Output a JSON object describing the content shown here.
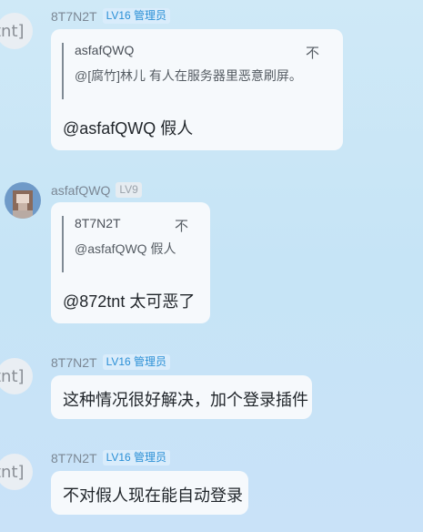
{
  "messages": [
    {
      "avatar_text": "tnt]",
      "sender": "8T7N2T",
      "badge": "LV16 管理员",
      "quote": {
        "author": "asfafQWQ",
        "mark": "不",
        "text": "@[腐竹]林儿 有人在服务器里恶意刷屏。"
      },
      "text": "@asfafQWQ 假人"
    },
    {
      "sender": "asfafQWQ",
      "badge": "LV9",
      "quote": {
        "author": "8T7N2T",
        "mark": "不",
        "text": "@asfafQWQ 假人"
      },
      "text": "@872tnt 太可恶了"
    },
    {
      "avatar_text": "tnt]",
      "sender": "8T7N2T",
      "badge": "LV16 管理员",
      "text": "这种情况很好解决，加个登录插件"
    },
    {
      "avatar_text": "tnt]",
      "sender": "8T7N2T",
      "badge": "LV16 管理员",
      "text": "不对假人现在能自动登录"
    }
  ],
  "colors": {
    "background": "#cfe9f7",
    "bubble": "#f6f9fc",
    "admin_badge_text": "#2a8fd6",
    "admin_badge_bg": "#d9ecfb"
  }
}
